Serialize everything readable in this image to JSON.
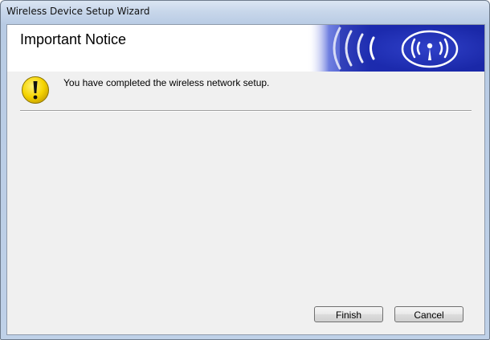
{
  "window": {
    "title": "Wireless Device Setup Wizard"
  },
  "header": {
    "title": "Important Notice",
    "banner_icon": "wireless-signal-icon",
    "banner_color": "#1f2fb8"
  },
  "notice": {
    "icon": "warning-icon",
    "icon_color": "#f5d400",
    "message": "You have completed the wireless network setup."
  },
  "buttons": {
    "finish_label": "Finish",
    "cancel_label": "Cancel"
  }
}
